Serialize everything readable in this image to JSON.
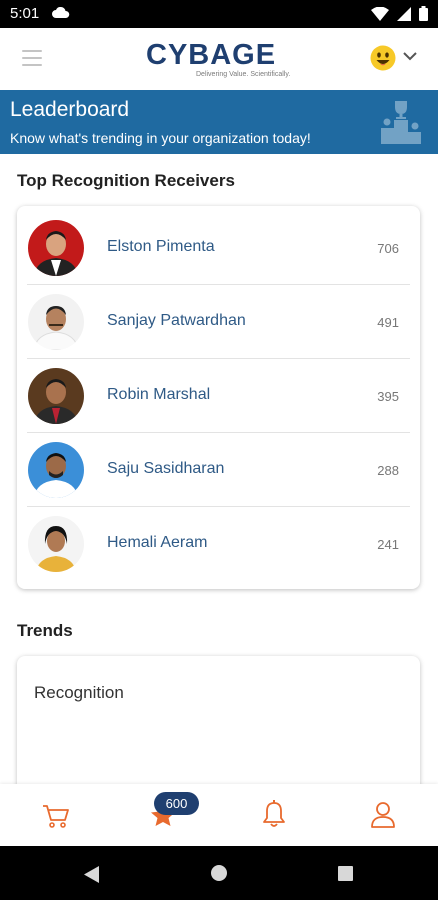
{
  "status": {
    "time": "5:01"
  },
  "header": {
    "logo_text": "CYBAGE",
    "logo_tagline": "Delivering Value. Scientifically."
  },
  "banner": {
    "title": "Leaderboard",
    "subtitle": "Know what's trending in your organization today!"
  },
  "top_receivers": {
    "title": "Top Recognition Receivers",
    "items": [
      {
        "name": "Elston Pimenta",
        "count": "706",
        "bg": "#c21a1a"
      },
      {
        "name": "Sanjay Patwardhan",
        "count": "491",
        "bg": "#f2f2f2"
      },
      {
        "name": "Robin Marshal",
        "count": "395",
        "bg": "#5a3a1f"
      },
      {
        "name": "Saju Sasidharan",
        "count": "288",
        "bg": "#3b8fd8"
      },
      {
        "name": "Hemali Aeram",
        "count": "241",
        "bg": "#f4f4f4"
      }
    ]
  },
  "trends": {
    "title": "Trends",
    "card_label": "Recognition"
  },
  "bottom_nav": {
    "badge": "600"
  },
  "colors": {
    "brand_blue": "#1f6aa1",
    "navy": "#1f3f70",
    "accent_orange": "#e86a2e"
  }
}
